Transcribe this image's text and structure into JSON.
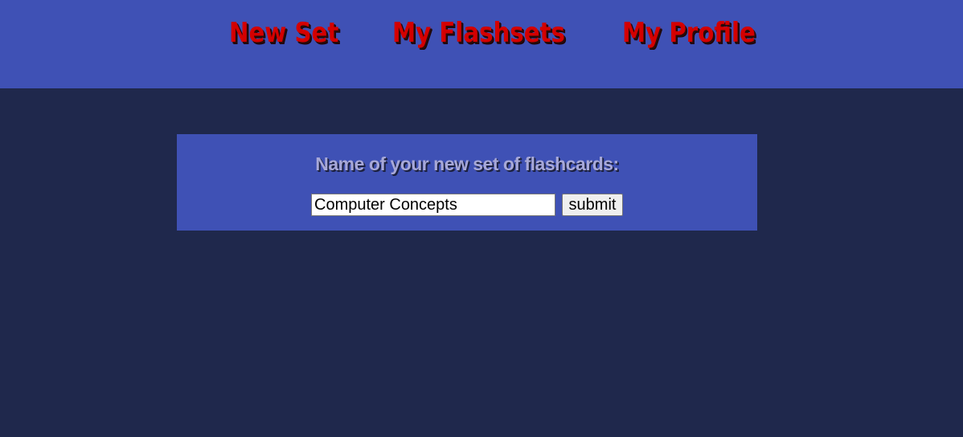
{
  "nav": {
    "items": [
      {
        "label": "New Set"
      },
      {
        "label": "My Flashsets"
      },
      {
        "label": "My Profile"
      }
    ]
  },
  "form": {
    "title": "Name of your new set of flashcards:",
    "name_value": "Computer Concepts",
    "submit_label": "submit"
  },
  "colors": {
    "header_bg": "#3f51b5",
    "page_bg": "#1f284c",
    "nav_text": "#d40000",
    "title_text": "#a7a8d8"
  }
}
